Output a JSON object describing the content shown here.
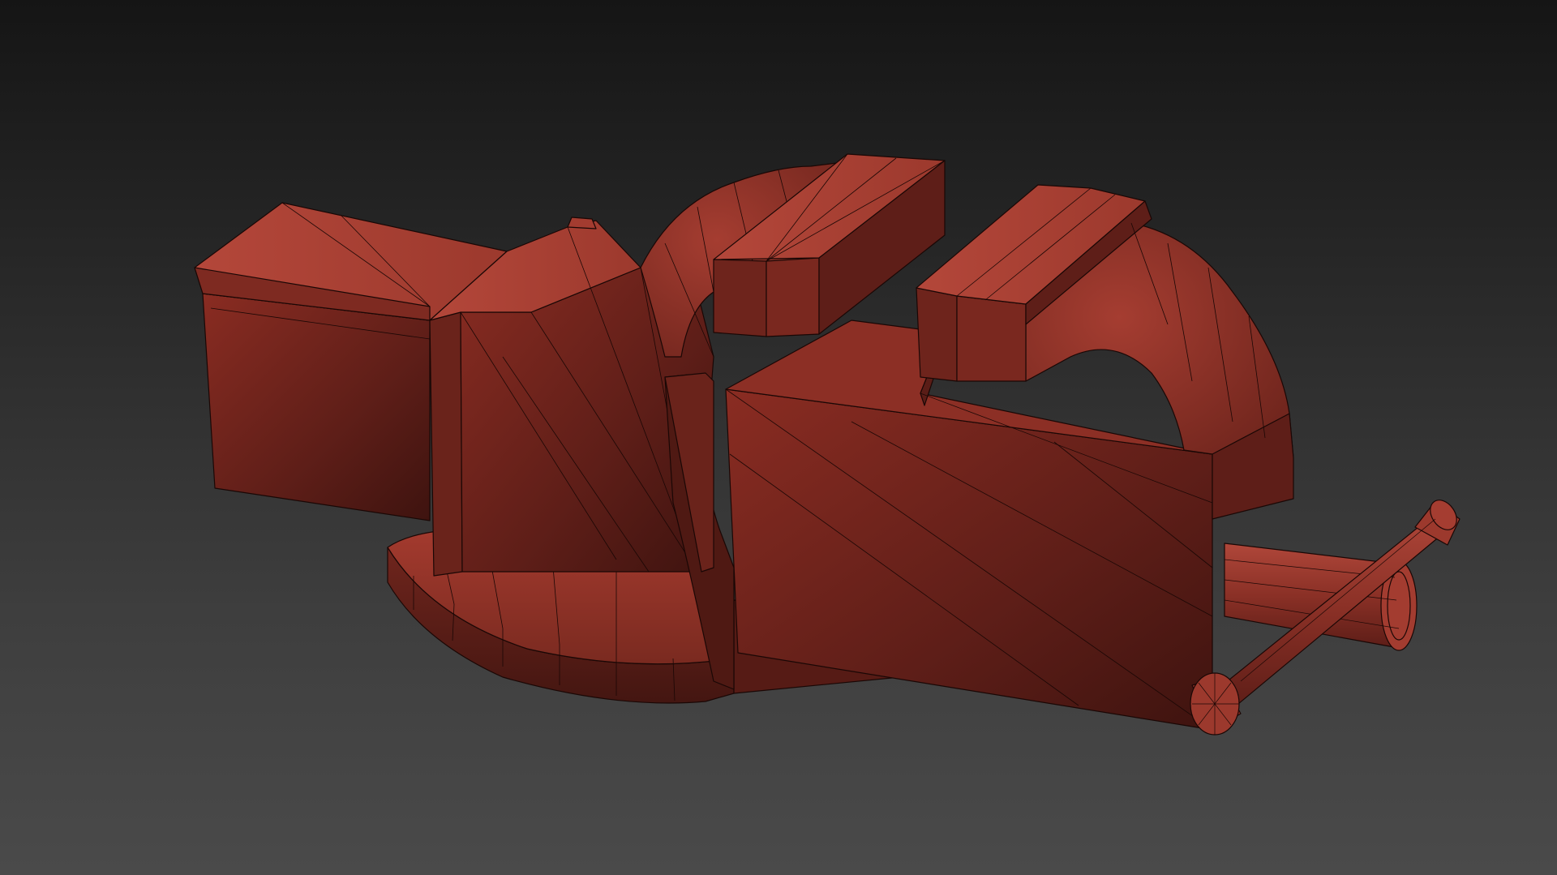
{
  "viewport": {
    "background_top": "#151515",
    "background_bottom": "#4a4a4a"
  },
  "model": {
    "colors": {
      "base": "#9a3328",
      "light": "#b4473a",
      "mid": "#7e2a21",
      "dark": "#5a1d17",
      "darker": "#3f1511",
      "edge": "#1a0705"
    }
  }
}
